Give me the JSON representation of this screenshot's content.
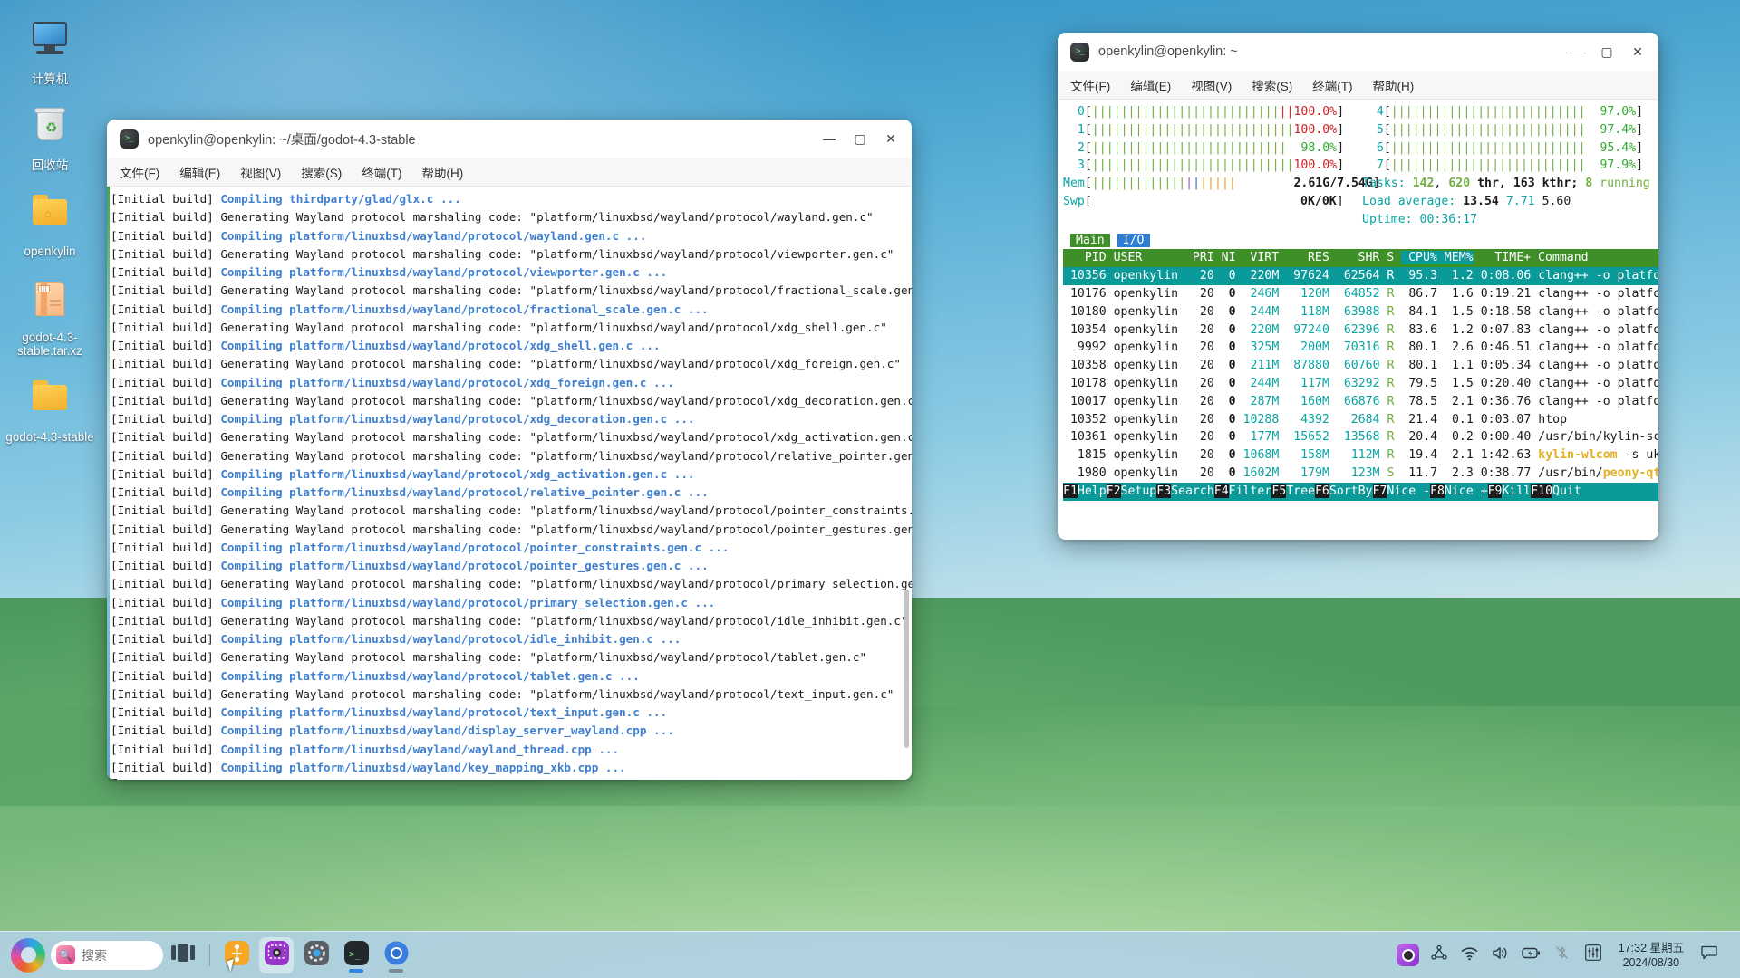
{
  "desktop": {
    "icons": [
      {
        "name": "computer",
        "label": "计算机"
      },
      {
        "name": "trash",
        "label": "回收站"
      },
      {
        "name": "home-folder",
        "label": "openkylin"
      },
      {
        "name": "archive",
        "label": "godot-4.3-stable.tar.xz"
      },
      {
        "name": "folder",
        "label": "godot-4.3-stable"
      }
    ]
  },
  "build_terminal": {
    "title": "openkylin@openkylin: ~/桌面/godot-4.3-stable",
    "menu": [
      "文件(F)",
      "编辑(E)",
      "视图(V)",
      "搜索(S)",
      "终端(T)",
      "帮助(H)"
    ],
    "window_buttons": {
      "minimize": "—",
      "maximize": "▢",
      "close": "✕"
    },
    "prefix": "[Initial build] ",
    "lines": [
      {
        "kind": "compiling",
        "text": "Compiling thirdparty/glad/glx.c ..."
      },
      {
        "kind": "generating",
        "text": "Generating Wayland protocol marshaling code: \"platform/linuxbsd/wayland/protocol/wayland.gen.c\""
      },
      {
        "kind": "compiling",
        "text": "Compiling platform/linuxbsd/wayland/protocol/wayland.gen.c ..."
      },
      {
        "kind": "generating",
        "text": "Generating Wayland protocol marshaling code: \"platform/linuxbsd/wayland/protocol/viewporter.gen.c\""
      },
      {
        "kind": "compiling",
        "text": "Compiling platform/linuxbsd/wayland/protocol/viewporter.gen.c ..."
      },
      {
        "kind": "generating",
        "text": "Generating Wayland protocol marshaling code: \"platform/linuxbsd/wayland/protocol/fractional_scale.gen.c\""
      },
      {
        "kind": "compiling",
        "text": "Compiling platform/linuxbsd/wayland/protocol/fractional_scale.gen.c ..."
      },
      {
        "kind": "generating",
        "text": "Generating Wayland protocol marshaling code: \"platform/linuxbsd/wayland/protocol/xdg_shell.gen.c\""
      },
      {
        "kind": "compiling",
        "text": "Compiling platform/linuxbsd/wayland/protocol/xdg_shell.gen.c ..."
      },
      {
        "kind": "generating",
        "text": "Generating Wayland protocol marshaling code: \"platform/linuxbsd/wayland/protocol/xdg_foreign.gen.c\""
      },
      {
        "kind": "compiling",
        "text": "Compiling platform/linuxbsd/wayland/protocol/xdg_foreign.gen.c ..."
      },
      {
        "kind": "generating",
        "text": "Generating Wayland protocol marshaling code: \"platform/linuxbsd/wayland/protocol/xdg_decoration.gen.c\""
      },
      {
        "kind": "compiling",
        "text": "Compiling platform/linuxbsd/wayland/protocol/xdg_decoration.gen.c ..."
      },
      {
        "kind": "generating",
        "text": "Generating Wayland protocol marshaling code: \"platform/linuxbsd/wayland/protocol/xdg_activation.gen.c\""
      },
      {
        "kind": "generating",
        "text": "Generating Wayland protocol marshaling code: \"platform/linuxbsd/wayland/protocol/relative_pointer.gen.c\""
      },
      {
        "kind": "compiling",
        "text": "Compiling platform/linuxbsd/wayland/protocol/xdg_activation.gen.c ..."
      },
      {
        "kind": "compiling",
        "text": "Compiling platform/linuxbsd/wayland/protocol/relative_pointer.gen.c ..."
      },
      {
        "kind": "generating",
        "text": "Generating Wayland protocol marshaling code: \"platform/linuxbsd/wayland/protocol/pointer_constraints.gen.c\""
      },
      {
        "kind": "generating",
        "text": "Generating Wayland protocol marshaling code: \"platform/linuxbsd/wayland/protocol/pointer_gestures.gen.c\""
      },
      {
        "kind": "compiling",
        "text": "Compiling platform/linuxbsd/wayland/protocol/pointer_constraints.gen.c ..."
      },
      {
        "kind": "compiling",
        "text": "Compiling platform/linuxbsd/wayland/protocol/pointer_gestures.gen.c ..."
      },
      {
        "kind": "generating",
        "text": "Generating Wayland protocol marshaling code: \"platform/linuxbsd/wayland/protocol/primary_selection.gen.c\""
      },
      {
        "kind": "compiling",
        "text": "Compiling platform/linuxbsd/wayland/protocol/primary_selection.gen.c ..."
      },
      {
        "kind": "generating",
        "text": "Generating Wayland protocol marshaling code: \"platform/linuxbsd/wayland/protocol/idle_inhibit.gen.c\""
      },
      {
        "kind": "compiling",
        "text": "Compiling platform/linuxbsd/wayland/protocol/idle_inhibit.gen.c ..."
      },
      {
        "kind": "generating",
        "text": "Generating Wayland protocol marshaling code: \"platform/linuxbsd/wayland/protocol/tablet.gen.c\""
      },
      {
        "kind": "compiling",
        "text": "Compiling platform/linuxbsd/wayland/protocol/tablet.gen.c ..."
      },
      {
        "kind": "generating",
        "text": "Generating Wayland protocol marshaling code: \"platform/linuxbsd/wayland/protocol/text_input.gen.c\""
      },
      {
        "kind": "compiling",
        "text": "Compiling platform/linuxbsd/wayland/protocol/text_input.gen.c ..."
      },
      {
        "kind": "compiling",
        "text": "Compiling platform/linuxbsd/wayland/display_server_wayland.cpp ..."
      },
      {
        "kind": "compiling",
        "text": "Compiling platform/linuxbsd/wayland/wayland_thread.cpp ..."
      },
      {
        "kind": "compiling",
        "text": "Compiling platform/linuxbsd/wayland/key_mapping_xkb.cpp ..."
      }
    ]
  },
  "htop_terminal": {
    "title": "openkylin@openkylin: ~",
    "menu": [
      "文件(F)",
      "编辑(E)",
      "视图(V)",
      "搜索(S)",
      "终端(T)",
      "帮助(H)"
    ],
    "window_buttons": {
      "minimize": "—",
      "maximize": "▢",
      "close": "✕"
    },
    "cpus": [
      {
        "id": "0",
        "pct": "100.0%",
        "fill": 1.0,
        "red": 0.07
      },
      {
        "id": "1",
        "pct": "100.0%",
        "fill": 1.0,
        "red": 0.0
      },
      {
        "id": "2",
        "pct": "98.0%",
        "fill": 0.98,
        "red": 0.0
      },
      {
        "id": "3",
        "pct": "100.0%",
        "fill": 1.0,
        "red": 0.0
      },
      {
        "id": "4",
        "pct": "97.0%",
        "fill": 0.97,
        "red": 0.0
      },
      {
        "id": "5",
        "pct": "97.4%",
        "fill": 0.97,
        "red": 0.0
      },
      {
        "id": "6",
        "pct": "95.4%",
        "fill": 0.95,
        "red": 0.0
      },
      {
        "id": "7",
        "pct": "97.9%",
        "fill": 0.97,
        "red": 0.0
      }
    ],
    "mem": {
      "label": "Mem",
      "value": "2.61G/7.54G",
      "fill": 0.7
    },
    "swp": {
      "label": "Swp",
      "value": "0K/0K",
      "fill": 0.0
    },
    "tasks": {
      "label": "Tasks:",
      "total": "142",
      "thr": "620",
      "thr_label": "thr,",
      "kthr": "163",
      "kthr_label": "kthr;",
      "running": "8",
      "running_label": "running"
    },
    "load": {
      "label": "Load average:",
      "v1": "13.54",
      "v2": "7.71",
      "v3": "5.60"
    },
    "uptime": {
      "label": "Uptime:",
      "value": "00:36:17"
    },
    "tabs": [
      {
        "label": "Main",
        "active": true
      },
      {
        "label": "I/O",
        "active": false
      }
    ],
    "columns": [
      "PID",
      "USER",
      "PRI",
      "NI",
      "VIRT",
      "RES",
      "SHR",
      "S",
      "CPU%",
      "MEM%",
      "TIME+",
      "Command"
    ],
    "processes": [
      {
        "pid": "10356",
        "user": "openkylin",
        "pri": "20",
        "ni": "0",
        "virt": "220M",
        "res": "97624",
        "shr": "62564",
        "s": "R",
        "cpu": "95.3",
        "mem": "1.2",
        "time": "0:08.06",
        "cmd": "clang++ -o platform/linuxb",
        "selected": true
      },
      {
        "pid": "10176",
        "user": "openkylin",
        "pri": "20",
        "ni": "0",
        "virt": "246M",
        "res": "120M",
        "shr": "64852",
        "s": "R",
        "cpu": "86.7",
        "mem": "1.6",
        "time": "0:19.21",
        "cmd": "clang++ -o platform/linuxb",
        "selected": false
      },
      {
        "pid": "10180",
        "user": "openkylin",
        "pri": "20",
        "ni": "0",
        "virt": "244M",
        "res": "118M",
        "shr": "63988",
        "s": "R",
        "cpu": "84.1",
        "mem": "1.5",
        "time": "0:18.58",
        "cmd": "clang++ -o platform/linuxb",
        "selected": false
      },
      {
        "pid": "10354",
        "user": "openkylin",
        "pri": "20",
        "ni": "0",
        "virt": "220M",
        "res": "97240",
        "shr": "62396",
        "s": "R",
        "cpu": "83.6",
        "mem": "1.2",
        "time": "0:07.83",
        "cmd": "clang++ -o platform/linuxb",
        "selected": false
      },
      {
        "pid": "9992",
        "user": "openkylin",
        "pri": "20",
        "ni": "0",
        "virt": "325M",
        "res": "200M",
        "shr": "70316",
        "s": "R",
        "cpu": "80.1",
        "mem": "2.6",
        "time": "0:46.51",
        "cmd": "clang++ -o platform/linuxb",
        "selected": false
      },
      {
        "pid": "10358",
        "user": "openkylin",
        "pri": "20",
        "ni": "0",
        "virt": "211M",
        "res": "87880",
        "shr": "60760",
        "s": "R",
        "cpu": "80.1",
        "mem": "1.1",
        "time": "0:05.34",
        "cmd": "clang++ -o platform/linuxb",
        "selected": false
      },
      {
        "pid": "10178",
        "user": "openkylin",
        "pri": "20",
        "ni": "0",
        "virt": "244M",
        "res": "117M",
        "shr": "63292",
        "s": "R",
        "cpu": "79.5",
        "mem": "1.5",
        "time": "0:20.40",
        "cmd": "clang++ -o platform/linuxb",
        "selected": false
      },
      {
        "pid": "10017",
        "user": "openkylin",
        "pri": "20",
        "ni": "0",
        "virt": "287M",
        "res": "160M",
        "shr": "66876",
        "s": "R",
        "cpu": "78.5",
        "mem": "2.1",
        "time": "0:36.76",
        "cmd": "clang++ -o platform/linuxb",
        "selected": false
      },
      {
        "pid": "10352",
        "user": "openkylin",
        "pri": "20",
        "ni": "0",
        "virt": "10288",
        "res": "4392",
        "shr": "2684",
        "s": "R",
        "cpu": "21.4",
        "mem": "0.1",
        "time": "0:03.07",
        "cmd": "htop",
        "selected": false
      },
      {
        "pid": "10361",
        "user": "openkylin",
        "pri": "20",
        "ni": "0",
        "virt": "177M",
        "res": "15652",
        "shr": "13568",
        "s": "R",
        "cpu": "20.4",
        "mem": "0.2",
        "time": "0:00.40",
        "cmd": "/usr/bin/kylin-screenshot",
        "selected": false
      },
      {
        "pid": "1815",
        "user": "openkylin",
        "pri": "20",
        "ni": "0",
        "virt": "1068M",
        "res": "158M",
        "shr": "112M",
        "s": "R",
        "cpu": "19.4",
        "mem": "2.1",
        "time": "1:42.63",
        "cmd": "kylin-wlcom -s ukui-sessio",
        "selected": false
      },
      {
        "pid": "1980",
        "user": "openkylin",
        "pri": "20",
        "ni": "0",
        "virt": "1602M",
        "res": "179M",
        "shr": "123M",
        "s": "S",
        "cpu": "11.7",
        "mem": "2.3",
        "time": "0:38.77",
        "cmd": "/usr/bin/peony-qt-desktop",
        "selected": false
      }
    ],
    "function_keys": [
      {
        "key": "F1",
        "label": "Help"
      },
      {
        "key": "F2",
        "label": "Setup"
      },
      {
        "key": "F3",
        "label": "Search"
      },
      {
        "key": "F4",
        "label": "Filter"
      },
      {
        "key": "F5",
        "label": "Tree"
      },
      {
        "key": "F6",
        "label": "SortBy"
      },
      {
        "key": "F7",
        "label": "Nice -"
      },
      {
        "key": "F8",
        "label": "Nice +"
      },
      {
        "key": "F9",
        "label": "Kill"
      },
      {
        "key": "F10",
        "label": "Quit"
      }
    ]
  },
  "taskbar": {
    "search_placeholder": "搜索",
    "items": [
      {
        "name": "task-view",
        "icon": "task-view-icon",
        "running": false
      },
      {
        "name": "kylin-software-center",
        "icon": "software-center-icon",
        "running": false
      },
      {
        "name": "kylin-screenshot",
        "icon": "screenshot-icon",
        "running": false
      },
      {
        "name": "settings",
        "icon": "gear-icon",
        "running": false
      },
      {
        "name": "terminal",
        "icon": "terminal-icon",
        "running": true
      },
      {
        "name": "browser",
        "icon": "browser-icon",
        "running": true
      }
    ],
    "tray": [
      {
        "name": "screenshot-tray",
        "icon": "camera-icon"
      },
      {
        "name": "kylin-assistant",
        "icon": "assistant-icon"
      },
      {
        "name": "network",
        "icon": "wifi-icon"
      },
      {
        "name": "volume",
        "icon": "speaker-icon"
      },
      {
        "name": "battery",
        "icon": "battery-icon"
      },
      {
        "name": "bluetooth",
        "icon": "bluetooth-off-icon"
      },
      {
        "name": "equalizer",
        "icon": "sliders-icon"
      }
    ],
    "clock": {
      "time": "17:32 星期五",
      "date": "2024/08/30"
    },
    "notifications_icon": "speech-bubble-icon"
  },
  "colors": {
    "accent": "#2f86dc",
    "htop_green": "#6fae3f",
    "htop_cyan": "#0a9a9a",
    "htop_header": "#3f8f28",
    "terminal_blue": "#3f7fd0"
  }
}
